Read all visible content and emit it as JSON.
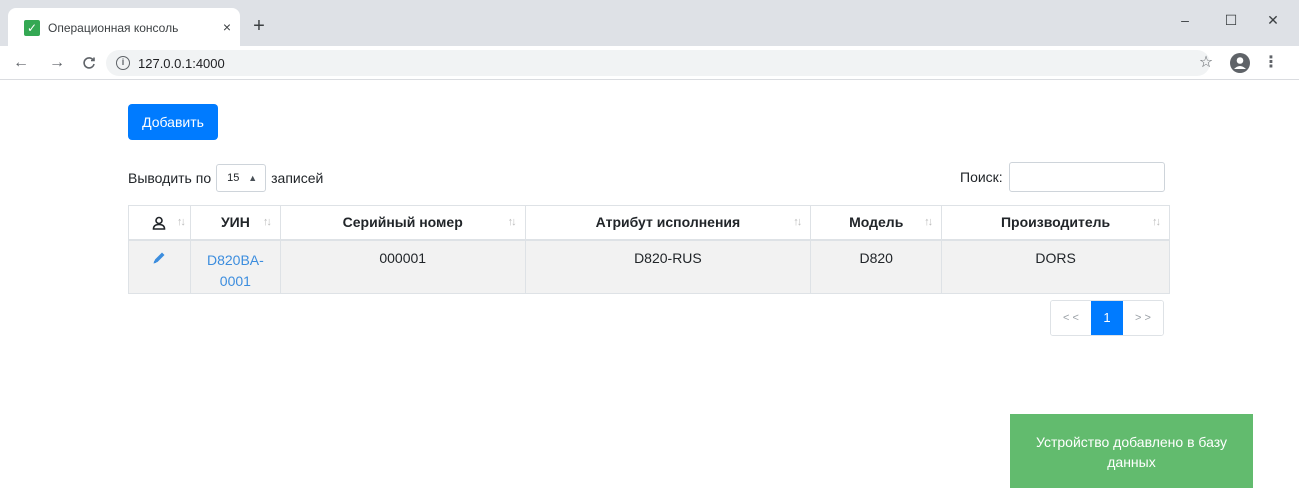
{
  "browser": {
    "tab_title": "Операционная консоль",
    "tab_close": "×",
    "new_tab": "+",
    "url": "127.0.0.1:4000",
    "window_controls": {
      "minimize": "–",
      "maximize": "☐",
      "close": "✕"
    },
    "icons": [
      "back-arrow-icon",
      "forward-arrow-icon",
      "reload-icon",
      "info-icon",
      "star-icon",
      "profile-icon",
      "menu-icon"
    ]
  },
  "toolbar": {
    "add_label": "Добавить"
  },
  "length": {
    "prefix": "Выводить по",
    "value": "15",
    "suffix": "записей"
  },
  "search": {
    "label": "Поиск:",
    "value": ""
  },
  "table": {
    "headers": [
      "УИН",
      "Серийный номер",
      "Атрибут исполнения",
      "Модель",
      "Производитель"
    ],
    "rows": [
      {
        "uin": "D820BA-0001",
        "serial": "000001",
        "attribute": "D820-RUS",
        "model": "D820",
        "vendor": "DORS"
      }
    ]
  },
  "pagination": {
    "prev": "< <",
    "current": "1",
    "next": "> >"
  },
  "toast": {
    "message": "Устройство добавлено в базу данных"
  },
  "colors": {
    "primary": "#007bff",
    "toast": "#62bb6e",
    "link": "#3c8dde"
  }
}
